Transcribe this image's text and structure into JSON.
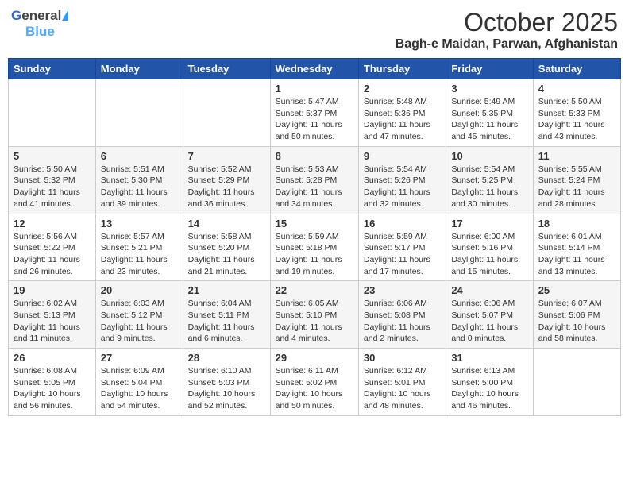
{
  "header": {
    "logo_general": "General",
    "logo_blue": "Blue",
    "month_title": "October 2025",
    "location": "Bagh-e Maidan, Parwan, Afghanistan"
  },
  "weekdays": [
    "Sunday",
    "Monday",
    "Tuesday",
    "Wednesday",
    "Thursday",
    "Friday",
    "Saturday"
  ],
  "weeks": [
    [
      {
        "day": "",
        "info": ""
      },
      {
        "day": "",
        "info": ""
      },
      {
        "day": "",
        "info": ""
      },
      {
        "day": "1",
        "info": "Sunrise: 5:47 AM\nSunset: 5:37 PM\nDaylight: 11 hours\nand 50 minutes."
      },
      {
        "day": "2",
        "info": "Sunrise: 5:48 AM\nSunset: 5:36 PM\nDaylight: 11 hours\nand 47 minutes."
      },
      {
        "day": "3",
        "info": "Sunrise: 5:49 AM\nSunset: 5:35 PM\nDaylight: 11 hours\nand 45 minutes."
      },
      {
        "day": "4",
        "info": "Sunrise: 5:50 AM\nSunset: 5:33 PM\nDaylight: 11 hours\nand 43 minutes."
      }
    ],
    [
      {
        "day": "5",
        "info": "Sunrise: 5:50 AM\nSunset: 5:32 PM\nDaylight: 11 hours\nand 41 minutes."
      },
      {
        "day": "6",
        "info": "Sunrise: 5:51 AM\nSunset: 5:30 PM\nDaylight: 11 hours\nand 39 minutes."
      },
      {
        "day": "7",
        "info": "Sunrise: 5:52 AM\nSunset: 5:29 PM\nDaylight: 11 hours\nand 36 minutes."
      },
      {
        "day": "8",
        "info": "Sunrise: 5:53 AM\nSunset: 5:28 PM\nDaylight: 11 hours\nand 34 minutes."
      },
      {
        "day": "9",
        "info": "Sunrise: 5:54 AM\nSunset: 5:26 PM\nDaylight: 11 hours\nand 32 minutes."
      },
      {
        "day": "10",
        "info": "Sunrise: 5:54 AM\nSunset: 5:25 PM\nDaylight: 11 hours\nand 30 minutes."
      },
      {
        "day": "11",
        "info": "Sunrise: 5:55 AM\nSunset: 5:24 PM\nDaylight: 11 hours\nand 28 minutes."
      }
    ],
    [
      {
        "day": "12",
        "info": "Sunrise: 5:56 AM\nSunset: 5:22 PM\nDaylight: 11 hours\nand 26 minutes."
      },
      {
        "day": "13",
        "info": "Sunrise: 5:57 AM\nSunset: 5:21 PM\nDaylight: 11 hours\nand 23 minutes."
      },
      {
        "day": "14",
        "info": "Sunrise: 5:58 AM\nSunset: 5:20 PM\nDaylight: 11 hours\nand 21 minutes."
      },
      {
        "day": "15",
        "info": "Sunrise: 5:59 AM\nSunset: 5:18 PM\nDaylight: 11 hours\nand 19 minutes."
      },
      {
        "day": "16",
        "info": "Sunrise: 5:59 AM\nSunset: 5:17 PM\nDaylight: 11 hours\nand 17 minutes."
      },
      {
        "day": "17",
        "info": "Sunrise: 6:00 AM\nSunset: 5:16 PM\nDaylight: 11 hours\nand 15 minutes."
      },
      {
        "day": "18",
        "info": "Sunrise: 6:01 AM\nSunset: 5:14 PM\nDaylight: 11 hours\nand 13 minutes."
      }
    ],
    [
      {
        "day": "19",
        "info": "Sunrise: 6:02 AM\nSunset: 5:13 PM\nDaylight: 11 hours\nand 11 minutes."
      },
      {
        "day": "20",
        "info": "Sunrise: 6:03 AM\nSunset: 5:12 PM\nDaylight: 11 hours\nand 9 minutes."
      },
      {
        "day": "21",
        "info": "Sunrise: 6:04 AM\nSunset: 5:11 PM\nDaylight: 11 hours\nand 6 minutes."
      },
      {
        "day": "22",
        "info": "Sunrise: 6:05 AM\nSunset: 5:10 PM\nDaylight: 11 hours\nand 4 minutes."
      },
      {
        "day": "23",
        "info": "Sunrise: 6:06 AM\nSunset: 5:08 PM\nDaylight: 11 hours\nand 2 minutes."
      },
      {
        "day": "24",
        "info": "Sunrise: 6:06 AM\nSunset: 5:07 PM\nDaylight: 11 hours\nand 0 minutes."
      },
      {
        "day": "25",
        "info": "Sunrise: 6:07 AM\nSunset: 5:06 PM\nDaylight: 10 hours\nand 58 minutes."
      }
    ],
    [
      {
        "day": "26",
        "info": "Sunrise: 6:08 AM\nSunset: 5:05 PM\nDaylight: 10 hours\nand 56 minutes."
      },
      {
        "day": "27",
        "info": "Sunrise: 6:09 AM\nSunset: 5:04 PM\nDaylight: 10 hours\nand 54 minutes."
      },
      {
        "day": "28",
        "info": "Sunrise: 6:10 AM\nSunset: 5:03 PM\nDaylight: 10 hours\nand 52 minutes."
      },
      {
        "day": "29",
        "info": "Sunrise: 6:11 AM\nSunset: 5:02 PM\nDaylight: 10 hours\nand 50 minutes."
      },
      {
        "day": "30",
        "info": "Sunrise: 6:12 AM\nSunset: 5:01 PM\nDaylight: 10 hours\nand 48 minutes."
      },
      {
        "day": "31",
        "info": "Sunrise: 6:13 AM\nSunset: 5:00 PM\nDaylight: 10 hours\nand 46 minutes."
      },
      {
        "day": "",
        "info": ""
      }
    ]
  ]
}
